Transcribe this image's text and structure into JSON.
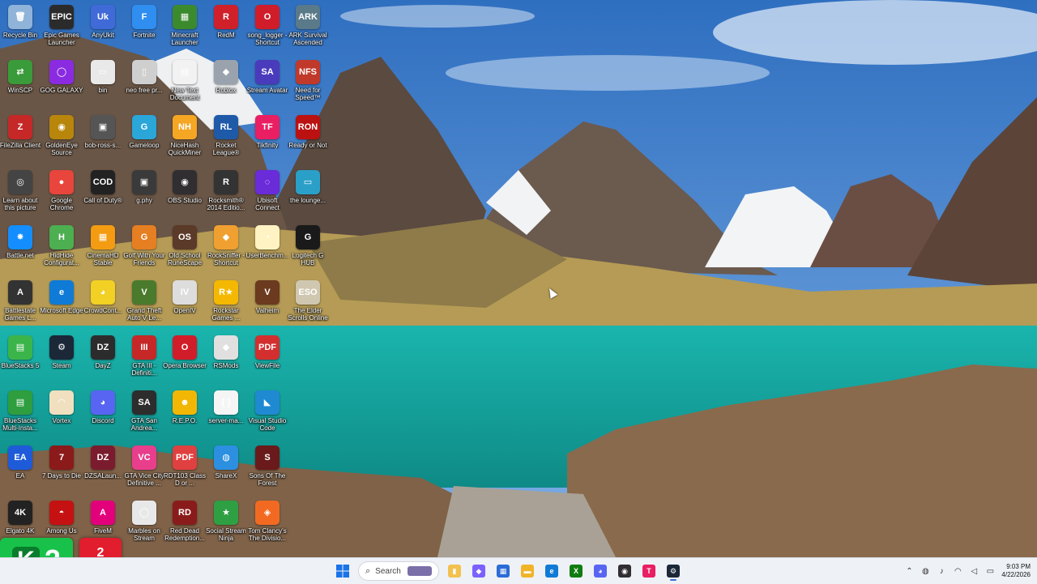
{
  "desktop": {
    "icons": [
      {
        "label": "Recycle Bin",
        "glyph": "🗑",
        "color": "#8fb3d9"
      },
      {
        "label": "Epic Games Launcher",
        "glyph": "EPIC",
        "color": "#2b2b2b"
      },
      {
        "label": "AnyUkit",
        "glyph": "Uk",
        "color": "#3f6ad8"
      },
      {
        "label": "Fortnite",
        "glyph": "F",
        "color": "#2f8ef0"
      },
      {
        "label": "Minecraft Launcher",
        "glyph": "▦",
        "color": "#3c8a2e"
      },
      {
        "label": "RedM",
        "glyph": "R",
        "color": "#d0202a"
      },
      {
        "label": "song_logger - Shortcut",
        "glyph": "O",
        "color": "#d11d2a"
      },
      {
        "label": "ARK Survival Ascended",
        "glyph": "ARK",
        "color": "#5a7a8a"
      },
      {
        "label": "WinSCP",
        "glyph": "⇄",
        "color": "#3a9b3a"
      },
      {
        "label": "GOG GALAXY",
        "glyph": "◯",
        "color": "#8a2be2"
      },
      {
        "label": "bin",
        "glyph": "▭",
        "color": "#e9e9e9"
      },
      {
        "label": "neo free pr...",
        "glyph": "▯",
        "color": "#cfcfcf"
      },
      {
        "label": "New Text Document",
        "glyph": "▤",
        "color": "#f2f2f2"
      },
      {
        "label": "Roblox",
        "glyph": "◆",
        "color": "#9aa3ad"
      },
      {
        "label": "Stream Avatar",
        "glyph": "SA",
        "color": "#4a3bbd"
      },
      {
        "label": "Need for Speed™",
        "glyph": "NFS",
        "color": "#c0392b"
      },
      {
        "label": "FileZilla Client",
        "glyph": "Z",
        "color": "#c62828"
      },
      {
        "label": "GoldenEye Source",
        "glyph": "◉",
        "color": "#b8860b"
      },
      {
        "label": "bob-ross-s...",
        "glyph": "▣",
        "color": "#555"
      },
      {
        "label": "Gameloop",
        "glyph": "G",
        "color": "#2aa6d9"
      },
      {
        "label": "NiceHash QuickMiner",
        "glyph": "NH",
        "color": "#f5a623"
      },
      {
        "label": "Rocket League®",
        "glyph": "RL",
        "color": "#1e5aa8"
      },
      {
        "label": "Tikfinity",
        "glyph": "TF",
        "color": "#e91e63"
      },
      {
        "label": "Ready or Not",
        "glyph": "RON",
        "color": "#b11"
      },
      {
        "label": "Learn about this picture",
        "glyph": "◎",
        "color": "#444"
      },
      {
        "label": "Google Chrome",
        "glyph": "●",
        "color": "#e8453c"
      },
      {
        "label": "Call of Duty®",
        "glyph": "COD",
        "color": "#222"
      },
      {
        "label": "g.phy",
        "glyph": "▣",
        "color": "#3a3a3a"
      },
      {
        "label": "OBS Studio",
        "glyph": "◉",
        "color": "#302e31"
      },
      {
        "label": "Rocksmith® 2014 Editio...",
        "glyph": "R",
        "color": "#333"
      },
      {
        "label": "Ubisoft Connect",
        "glyph": "◌",
        "color": "#6a2bd9"
      },
      {
        "label": "the lounge...",
        "glyph": "▭",
        "color": "#2aa0c8"
      },
      {
        "label": "Battle.net",
        "glyph": "✸",
        "color": "#148eff"
      },
      {
        "label": "HidHide Configurat...",
        "glyph": "H",
        "color": "#4caf50"
      },
      {
        "label": "CinemaHD Stable",
        "glyph": "▦",
        "color": "#f39c12"
      },
      {
        "label": "Golf With Your Friends",
        "glyph": "G",
        "color": "#e67e22"
      },
      {
        "label": "Old School RuneScape",
        "glyph": "OS",
        "color": "#5b3a29"
      },
      {
        "label": "RockSniffer - Shortcut",
        "glyph": "◆",
        "color": "#f0a030"
      },
      {
        "label": "UserBenchm...",
        "glyph": "◔",
        "color": "#fff3c4"
      },
      {
        "label": "Logitech G HUB",
        "glyph": "G",
        "color": "#1a1a1a"
      },
      {
        "label": "Battlestate Games L...",
        "glyph": "A",
        "color": "#333"
      },
      {
        "label": "Microsoft Edge",
        "glyph": "e",
        "color": "#0f7bd6"
      },
      {
        "label": "CrowdCont...",
        "glyph": "◕",
        "color": "#f2d024"
      },
      {
        "label": "Grand Theft Auto V Le...",
        "glyph": "V",
        "color": "#4a7a2b"
      },
      {
        "label": "OpenIV",
        "glyph": "IV",
        "color": "#ddd"
      },
      {
        "label": "Rockstar Games ...",
        "glyph": "R★",
        "color": "#f5b800"
      },
      {
        "label": "Valheim",
        "glyph": "V",
        "color": "#6b3a1f"
      },
      {
        "label": "The Elder Scrolls Online",
        "glyph": "ESO",
        "color": "#cfc7b0"
      },
      {
        "label": "BlueStacks 5",
        "glyph": "▤",
        "color": "#3bb54a"
      },
      {
        "label": "Steam",
        "glyph": "⚙",
        "color": "#1b2838"
      },
      {
        "label": "DayZ",
        "glyph": "DZ",
        "color": "#2c2c2c"
      },
      {
        "label": "GTA III - Definiti...",
        "glyph": "III",
        "color": "#c62828"
      },
      {
        "label": "Opera Browser",
        "glyph": "O",
        "color": "#d11d2a"
      },
      {
        "label": "RSMods",
        "glyph": "◆",
        "color": "#e0e0e0"
      },
      {
        "label": "ViewFile",
        "glyph": "PDF",
        "color": "#d32f2f"
      },
      {
        "label": "BlueStacks Multi-Insta...",
        "glyph": "▤",
        "color": "#2e9e3e"
      },
      {
        "label": "Vortex",
        "glyph": "◠",
        "color": "#f0e0c0"
      },
      {
        "label": "Discord",
        "glyph": "◕",
        "color": "#5865f2"
      },
      {
        "label": "GTA San Andrea...",
        "glyph": "SA",
        "color": "#2d2d2d"
      },
      {
        "label": "R.E.P.O.",
        "glyph": "☻",
        "color": "#f2b705"
      },
      {
        "label": "server-ma...",
        "glyph": "{ }",
        "color": "#f5f5f5"
      },
      {
        "label": "Visual Studio Code",
        "glyph": "◣",
        "color": "#1f8ad2"
      },
      {
        "label": "EA",
        "glyph": "EA",
        "color": "#1e5bd8"
      },
      {
        "label": "7 Days to Die",
        "glyph": "7",
        "color": "#8b1a1a"
      },
      {
        "label": "DZSALaun...",
        "glyph": "DZ",
        "color": "#7a1c2e"
      },
      {
        "label": "GTA Vice City Definitive ...",
        "glyph": "VC",
        "color": "#e83e8c"
      },
      {
        "label": "RDT103 Class D or ...",
        "glyph": "PDF",
        "color": "#e04040"
      },
      {
        "label": "ShareX",
        "glyph": "◍",
        "color": "#2c8fe0"
      },
      {
        "label": "Sons Of The Forest",
        "glyph": "S",
        "color": "#6a1a1a"
      },
      {
        "label": "Elgato 4K",
        "glyph": "4K",
        "color": "#222"
      },
      {
        "label": "Among Us",
        "glyph": "◓",
        "color": "#c51111"
      },
      {
        "label": "FiveM",
        "glyph": "A",
        "color": "#e3007b"
      },
      {
        "label": "Marbles on Stream",
        "glyph": "◯",
        "color": "#e8e8e8"
      },
      {
        "label": "Red Dead Redemption...",
        "glyph": "RD",
        "color": "#8a1b1b"
      },
      {
        "label": "Social Stream Ninja",
        "glyph": "★",
        "color": "#2ea043"
      },
      {
        "label": "Tom Clancy's The Divisio...",
        "glyph": "◈",
        "color": "#f26a21"
      }
    ]
  },
  "widgets": {
    "kick_letter": "K",
    "kick_count": "2",
    "stats_line1": "2",
    "stats_line2": "2"
  },
  "taskbar": {
    "search_placeholder": "Search",
    "apps": [
      {
        "name": "file-explorer",
        "glyph": "▮",
        "color": "#f2c14e"
      },
      {
        "name": "copilot",
        "glyph": "◆",
        "color": "#7b61ff"
      },
      {
        "name": "ms-store",
        "glyph": "▦",
        "color": "#2b6cd6"
      },
      {
        "name": "folder",
        "glyph": "▬",
        "color": "#f0b429"
      },
      {
        "name": "edge",
        "glyph": "e",
        "color": "#0f7bd6"
      },
      {
        "name": "xbox",
        "glyph": "X",
        "color": "#107c10"
      },
      {
        "name": "discord",
        "glyph": "◕",
        "color": "#5865f2"
      },
      {
        "name": "obs",
        "glyph": "◉",
        "color": "#302e31"
      },
      {
        "name": "tikfinity",
        "glyph": "T",
        "color": "#e91e63"
      },
      {
        "name": "steam",
        "glyph": "⚙",
        "color": "#1b2838"
      }
    ],
    "time": "9:03 PM",
    "date": "4/22/2026"
  },
  "colors": {
    "sky": "#3d7cc9",
    "lake": "#1fa5a0",
    "taskbar_bg": "#eef1f6"
  }
}
